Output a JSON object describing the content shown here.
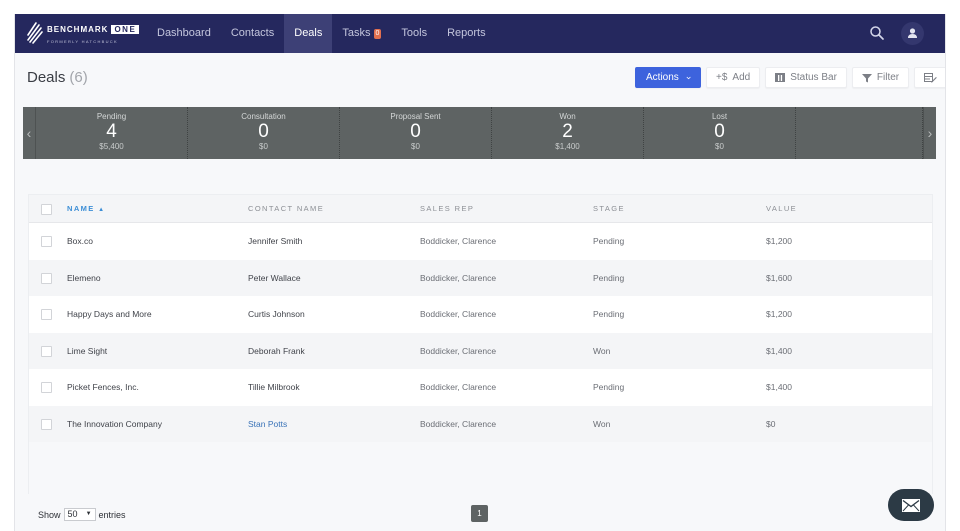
{
  "brand": {
    "name": "BENCHMARK",
    "name_highlight": "ONE",
    "tagline": "FORMERLY HATCHBUCK"
  },
  "nav": {
    "items": [
      {
        "label": "Dashboard",
        "active": false
      },
      {
        "label": "Contacts",
        "active": false
      },
      {
        "label": "Deals",
        "active": true
      },
      {
        "label": "Tasks",
        "active": false,
        "badge": "0"
      },
      {
        "label": "Tools",
        "active": false
      },
      {
        "label": "Reports",
        "active": false
      }
    ],
    "search_icon": "search-icon",
    "user_icon": "user-icon"
  },
  "page": {
    "title": "Deals",
    "count": "(6)"
  },
  "toolbar": {
    "actions_label": "Actions",
    "add_label": "Add",
    "add_prefix": "+$",
    "status_bar_label": "Status Bar",
    "filter_label": "Filter",
    "edit_columns_icon": "edit-columns-icon"
  },
  "status_bar": {
    "stages": [
      {
        "label": "Pending",
        "count": "4",
        "amount": "$5,400"
      },
      {
        "label": "Consultation",
        "count": "0",
        "amount": "$0"
      },
      {
        "label": "Proposal Sent",
        "count": "0",
        "amount": "$0"
      },
      {
        "label": "Won",
        "count": "2",
        "amount": "$1,400"
      },
      {
        "label": "Lost",
        "count": "0",
        "amount": "$0"
      },
      {
        "label": "",
        "count": "",
        "amount": ""
      }
    ],
    "prev_arrow": "‹",
    "next_arrow": "›"
  },
  "table": {
    "columns": [
      "NAME",
      "CONTACT NAME",
      "SALES REP",
      "STAGE",
      "VALUE"
    ],
    "sort_indicator": "▲",
    "rows": [
      {
        "name": "Box.co",
        "contact": "Jennifer Smith",
        "rep": "Boddicker, Clarence",
        "stage": "Pending",
        "value": "$1,200",
        "contact_link": false
      },
      {
        "name": "Elemeno",
        "contact": "Peter Wallace",
        "rep": "Boddicker, Clarence",
        "stage": "Pending",
        "value": "$1,600",
        "contact_link": false
      },
      {
        "name": "Happy Days and More",
        "contact": "Curtis Johnson",
        "rep": "Boddicker, Clarence",
        "stage": "Pending",
        "value": "$1,200",
        "contact_link": false
      },
      {
        "name": "Lime Sight",
        "contact": "Deborah Frank",
        "rep": "Boddicker, Clarence",
        "stage": "Won",
        "value": "$1,400",
        "contact_link": false
      },
      {
        "name": "Picket Fences, Inc.",
        "contact": "Tillie Milbrook",
        "rep": "Boddicker, Clarence",
        "stage": "Pending",
        "value": "$1,400",
        "contact_link": false
      },
      {
        "name": "The Innovation Company",
        "contact": "Stan Potts",
        "rep": "Boddicker, Clarence",
        "stage": "Won",
        "value": "$0",
        "contact_link": true
      }
    ]
  },
  "footer": {
    "show_label": "Show",
    "entries_value": "50",
    "entries_label": "entries",
    "current_page": "1"
  },
  "colors": {
    "nav_bg": "#25285e",
    "primary": "#3d63dd",
    "status_bar_bg": "#5e6363",
    "link": "#3a73b8",
    "sort_header": "#3c8ed6",
    "badge": "#e2704f"
  }
}
